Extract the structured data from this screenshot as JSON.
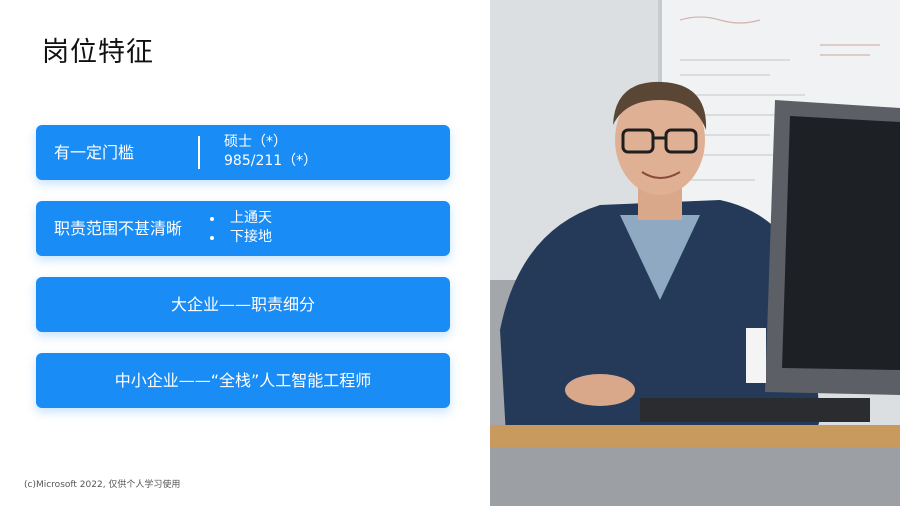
{
  "title": "岗位特征",
  "cards": [
    {
      "label": "有一定门槛",
      "details": [
        "硕士（*）",
        "985/211（*）"
      ]
    },
    {
      "label": "职责范围不甚清晰",
      "bullets": [
        "上通天",
        "下接地"
      ]
    },
    {
      "text": "大企业——职责细分"
    },
    {
      "text": "中小企业——“全栈”人工智能工程师"
    }
  ],
  "footer": "(c)Microsoft 2022, 仅供个人学习使用",
  "colors": {
    "card": "#1a8cf5",
    "title": "#111111"
  }
}
